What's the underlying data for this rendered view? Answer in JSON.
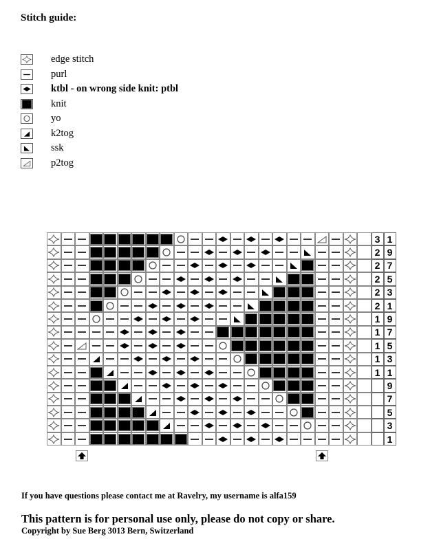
{
  "title": "Stitch guide:",
  "legend": [
    {
      "symbol": "E",
      "icon": "edge-stitch-icon",
      "label": "edge stitch",
      "bold": false
    },
    {
      "symbol": "P",
      "icon": "purl-icon",
      "label": "purl",
      "bold": false
    },
    {
      "symbol": "T",
      "icon": "ktbl-diamond-icon",
      "label": "ktbl  - on wrong side knit: ptbl",
      "bold": true
    },
    {
      "symbol": "K",
      "icon": "knit-square-icon",
      "label": "knit",
      "bold": false
    },
    {
      "symbol": "O",
      "icon": "yo-circle-icon",
      "label": "yo",
      "bold": false
    },
    {
      "symbol": "L",
      "icon": "k2tog-icon",
      "label": "k2tog",
      "bold": false
    },
    {
      "symbol": "S",
      "icon": "ssk-icon",
      "label": "ssk",
      "bold": false
    },
    {
      "symbol": "Q",
      "icon": "p2tog-icon",
      "label": "p2tog",
      "bold": false
    }
  ],
  "chart": {
    "rows": [
      {
        "number": "31",
        "stitches": "EPPKKKKKKOPPTPTPTPPQPE"
      },
      {
        "number": "29",
        "stitches": "EPPKKKKKOPPTPTPTPPSPPE"
      },
      {
        "number": "27",
        "stitches": "EPPKKKKOPPTPTPTPPSKPPE"
      },
      {
        "number": "25",
        "stitches": "EPPKKKOPPTPTPTPPSKKPPE"
      },
      {
        "number": "23",
        "stitches": "EPPKKOPPTPTPTPPSKKKPPE"
      },
      {
        "number": "21",
        "stitches": "EPPKOPPTPTPTPPSKKKKPPE"
      },
      {
        "number": "19",
        "stitches": "EPPOPPTPTPTPPSKKKKKPPE"
      },
      {
        "number": "17",
        "stitches": "EPPPPTPTPTPPKKKKKKKPPE"
      },
      {
        "number": "15",
        "stitches": "EPQPPTPTPTPPOKKKKKKPPE"
      },
      {
        "number": "13",
        "stitches": "EPPLPPTPTPTPPOKKKKKPPE"
      },
      {
        "number": "11",
        "stitches": "EPPKLPPTPTPTPPOKKKKPPE"
      },
      {
        "number": "9",
        "stitches": "EPPKKLPPTPTPTPPOKKKPPE"
      },
      {
        "number": "7",
        "stitches": "EPPKKKLPPTPTPTPPOKKPPE"
      },
      {
        "number": "5",
        "stitches": "EPPKKKKLPPTPTPTPPOKPPE"
      },
      {
        "number": "3",
        "stitches": "EPPKKKKKLPPTPTPTPPOPPE"
      },
      {
        "number": "1",
        "stitches": "EPPKKKKKKKPPTPTPTPPPPE"
      }
    ],
    "repeat_markers": {
      "icon": "up-arrow-icon",
      "columns": [
        3,
        20
      ]
    }
  },
  "footer": {
    "contact": "If you have questions please contact me at Ravelry, my username is alfa159",
    "personal_use": "This pattern is for personal use only, please do not copy or share.",
    "copyright": "Copyright by Sue Berg 3013 Bern, Switzerland"
  }
}
